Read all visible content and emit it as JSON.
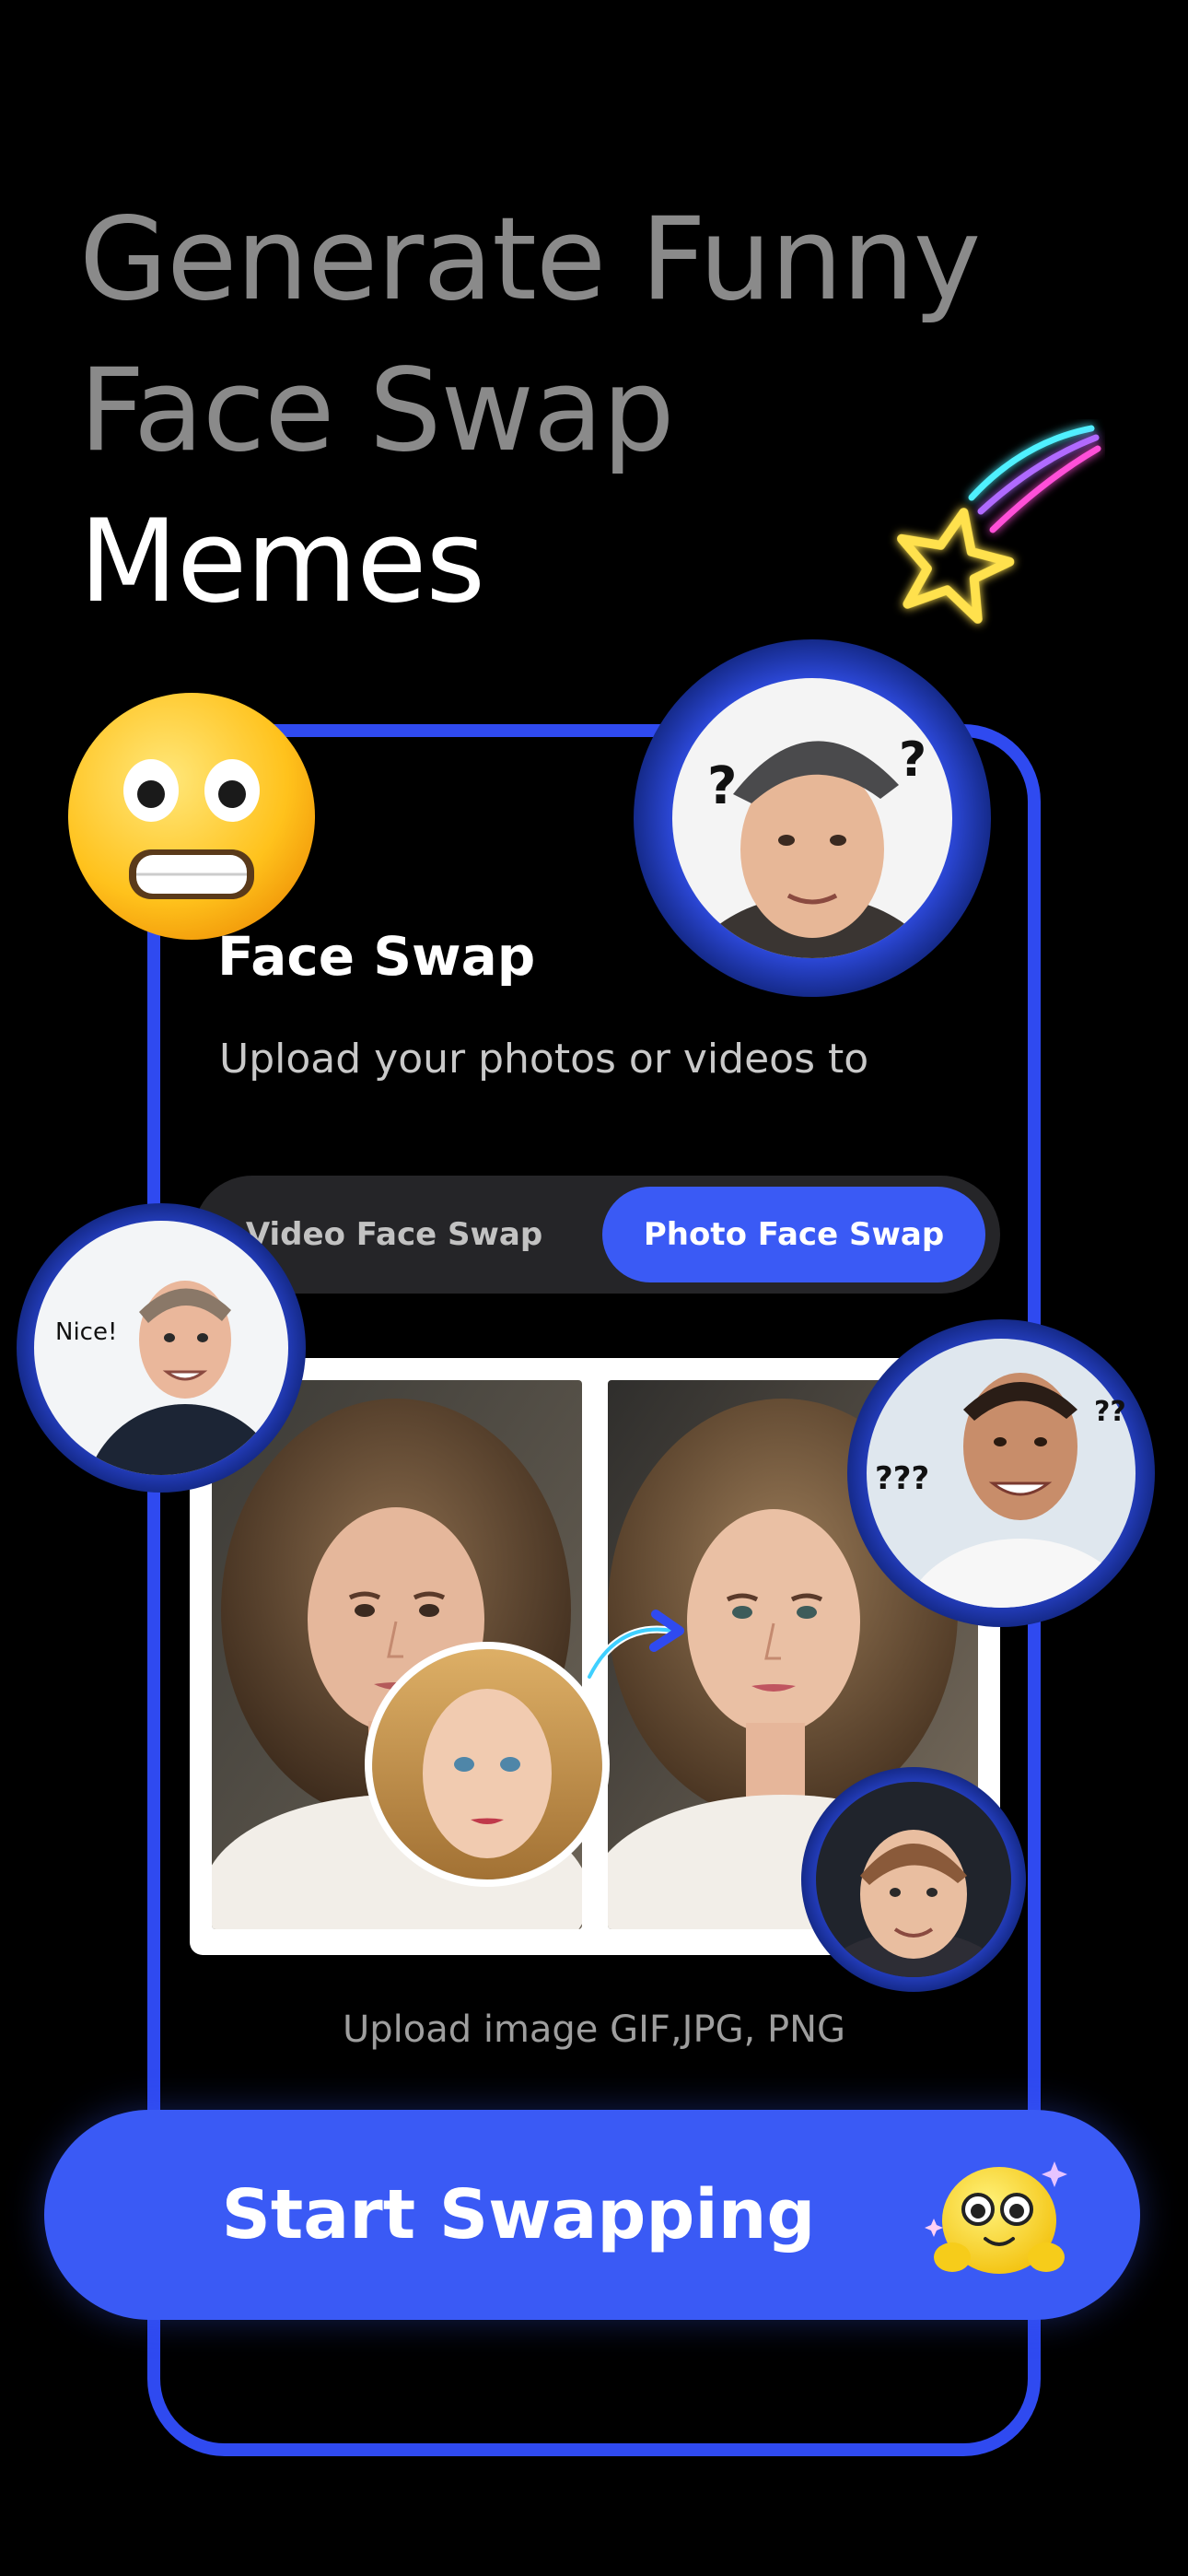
{
  "headline": {
    "line1": "Generate Funny",
    "line2": "Face Swap",
    "line3": "Memes"
  },
  "card": {
    "title": "Face Swap",
    "subtitle": "Upload your photos or videos to"
  },
  "mode_toggle": {
    "options": [
      "Video Face Swap",
      "Photo Face Swap"
    ],
    "selected": "Photo Face Swap"
  },
  "stickers": {
    "nice": "Nice!",
    "question_marks": "???",
    "question_mark": "?",
    "double_question": "??"
  },
  "upload_note": "Upload image GIF,JPG, PNG",
  "cta": {
    "label": "Start Swapping"
  },
  "colors": {
    "background": "#000000",
    "accent": "#3a5af5",
    "frame": "#2f4af0",
    "headline_gray": "#8a8a8a",
    "neon_yellow": "#ffe14d",
    "neon_pink": "#ff4fd8",
    "neon_cyan": "#4ff1ff"
  }
}
